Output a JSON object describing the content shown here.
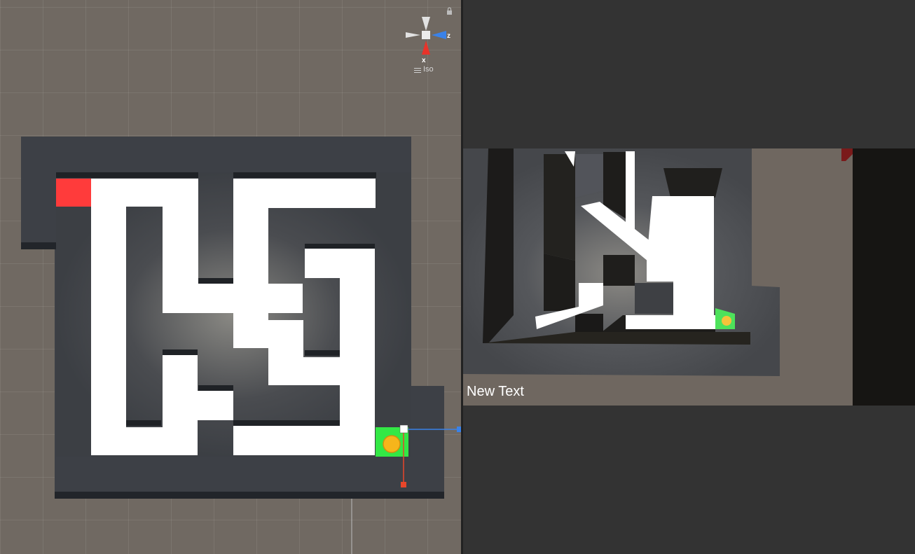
{
  "scene": {
    "gizmo": {
      "axis_x_label": "x",
      "axis_z_label": "z",
      "projection_label": "Iso",
      "menu_icon": "hamburger-icon",
      "lock_icon": "lock-icon"
    },
    "colors": {
      "wall": "#3a3e44",
      "floor": "#ffffff",
      "start": "#ff3b3b",
      "goal": "#33e845",
      "player": "#f6b51b"
    }
  },
  "game": {
    "ui_text": "New Text"
  }
}
